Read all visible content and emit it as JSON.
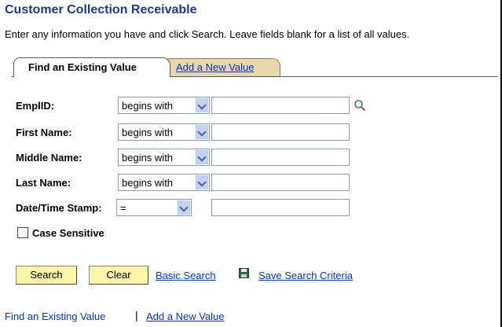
{
  "page": {
    "title": "Customer Collection Receivable",
    "instructions": "Enter any information you have and click Search. Leave fields blank for a list of all values."
  },
  "tabs": {
    "active_label": "Find an Existing Value",
    "inactive_label": "Add a New Value"
  },
  "form": {
    "fields": [
      {
        "label": "EmplID:",
        "operator": "begins with",
        "value": ""
      },
      {
        "label": "First Name:",
        "operator": "begins with",
        "value": ""
      },
      {
        "label": "Middle Name:",
        "operator": "begins with",
        "value": ""
      },
      {
        "label": "Last Name:",
        "operator": "begins with",
        "value": ""
      },
      {
        "label": "Date/Time Stamp:",
        "operator": "=",
        "value": ""
      }
    ],
    "case_sensitive_label": "Case Sensitive",
    "case_sensitive_checked": false
  },
  "actions": {
    "search_label": "Search",
    "clear_label": "Clear",
    "basic_search_label": "Basic Search",
    "save_criteria_label": "Save Search Criteria"
  },
  "footer": {
    "find_link": "Find an Existing Value",
    "separator": "|",
    "add_link": "Add a New Value"
  },
  "icons": {
    "lookup": "magnifier-icon",
    "save": "floppy-disk-icon",
    "dropdown": "chevron-down-icon"
  },
  "colors": {
    "title": "#1a3b8c",
    "link": "#0033cc",
    "button_bg": "#fcf4a6",
    "inactive_tab_bg": "#e7d7ad"
  }
}
